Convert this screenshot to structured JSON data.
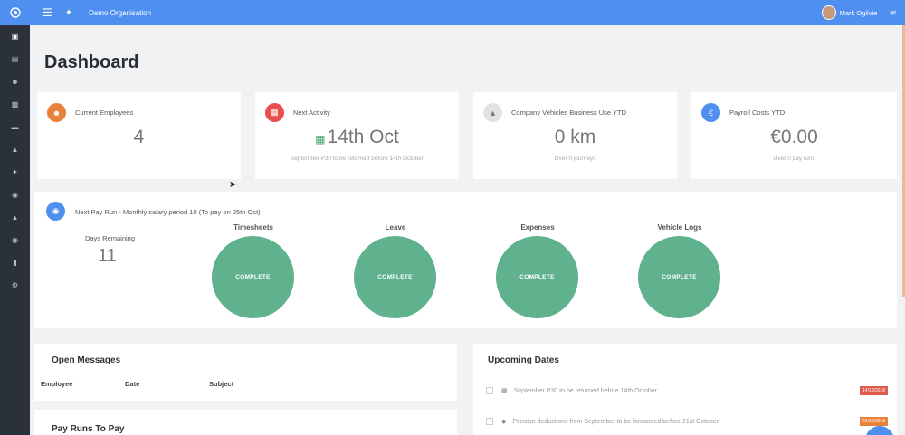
{
  "topbar": {
    "org": "Demo Organisation",
    "user": "Mark Ogilvie"
  },
  "page": {
    "title": "Dashboard"
  },
  "stats": [
    {
      "label": "Current Employees",
      "value": "4",
      "sub": "",
      "color": "#e8823b",
      "icon": "users-icon"
    },
    {
      "label": "Next Activity",
      "value": "14th Oct",
      "sub": "September P30 to be returned before 14th October",
      "color": "#e94f4f",
      "icon": "calendar-icon"
    },
    {
      "label": "Company Vehicles Business Use YTD",
      "value": "0 km",
      "sub": "Over 0 journeys",
      "color": "#e3e3e3",
      "icon": "car-icon"
    },
    {
      "label": "Payroll Costs YTD",
      "value": "€0.00",
      "sub": "Over 0 pay runs",
      "color": "#4f8ff0",
      "icon": "euro-icon"
    }
  ],
  "payrun": {
    "label": "Next Pay Run - Monthly salary period 10 (To pay on 25th Oct)",
    "days_label": "Days Remaining",
    "days_value": "11",
    "steps": [
      {
        "title": "Timesheets",
        "status": "COMPLETE"
      },
      {
        "title": "Leave",
        "status": "COMPLETE"
      },
      {
        "title": "Expenses",
        "status": "COMPLETE"
      },
      {
        "title": "Vehicle Logs",
        "status": "COMPLETE"
      }
    ]
  },
  "messages": {
    "title": "Open Messages",
    "columns": [
      "Employee",
      "Date",
      "Subject"
    ],
    "next_title": "Pay Runs To Pay"
  },
  "upcoming": {
    "title": "Upcoming Dates",
    "items": [
      {
        "text": "September P30 to be returned before 14th October",
        "badge": "14/10/2018",
        "badge_color": "#e05a4a",
        "icon": "calendar-icon"
      },
      {
        "text": "Pension deductions from September to be forwarded before 21st October",
        "badge": "21/10/2018",
        "badge_color": "#e8823b",
        "icon": "diamond-icon"
      }
    ]
  },
  "colors": {
    "accent": "#4f8ff0",
    "sidebar": "#2a313a",
    "complete": "#5fb28d"
  }
}
